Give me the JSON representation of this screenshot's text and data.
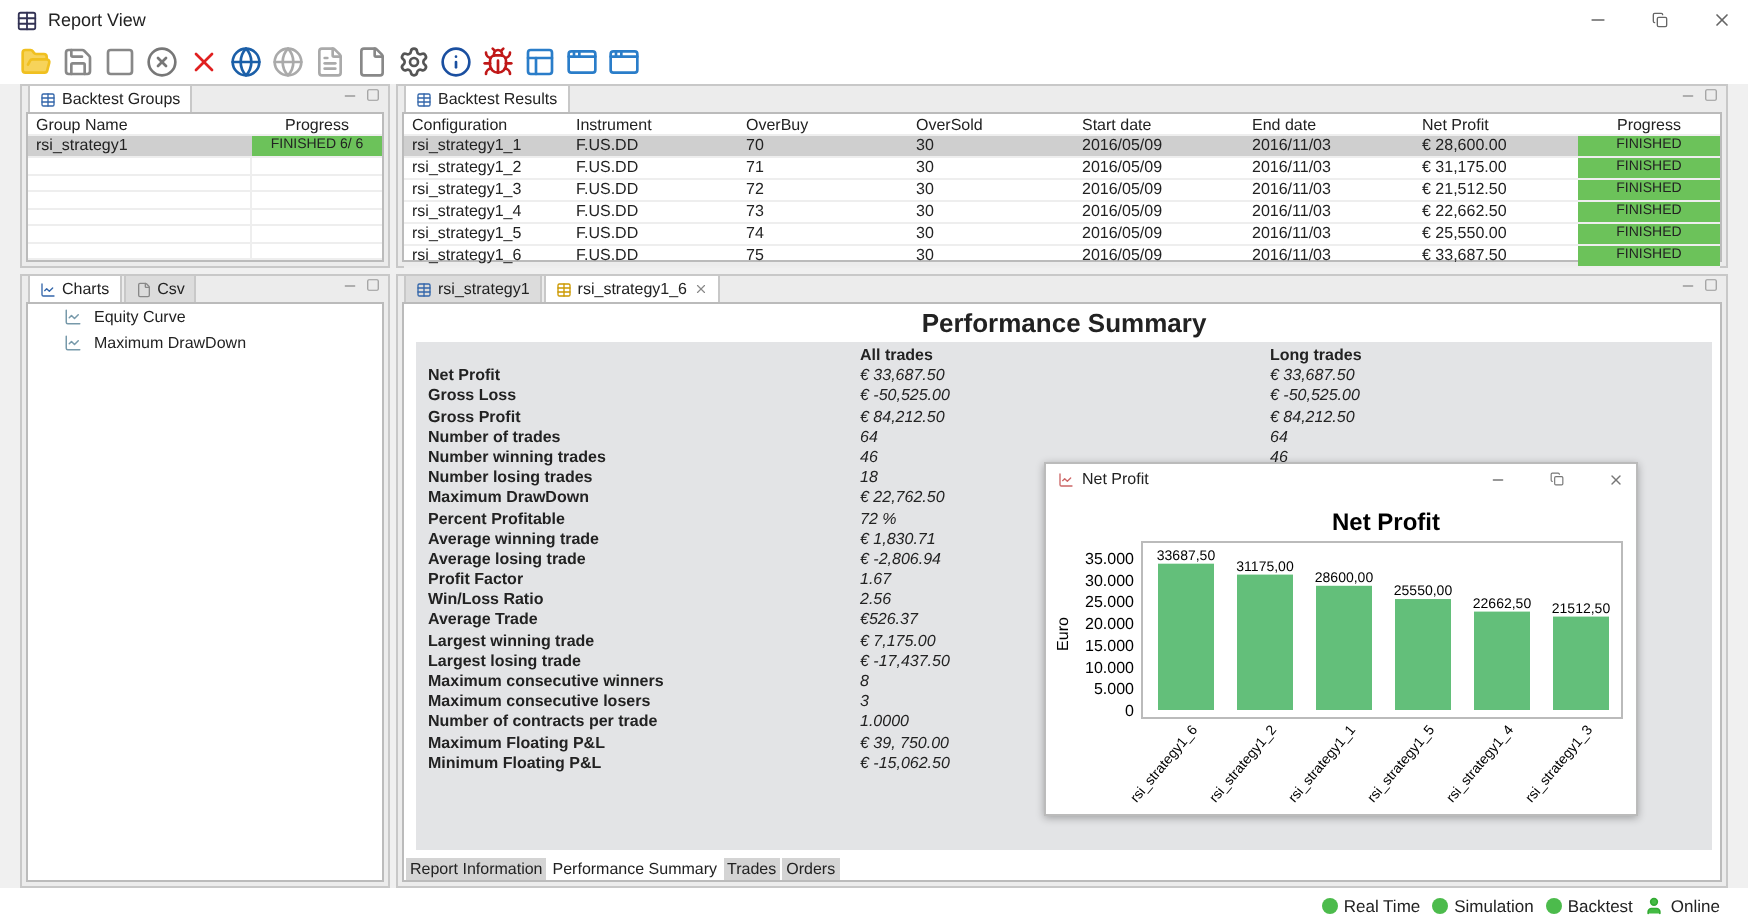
{
  "window": {
    "title": "Report View"
  },
  "groups_panel": {
    "tab": "Backtest Groups",
    "columns": [
      "Group Name",
      "Progress"
    ],
    "rows": [
      {
        "name": "rsi_strategy1",
        "progress": "FINISHED 6/ 6",
        "selected": true
      }
    ]
  },
  "results_panel": {
    "tab": "Backtest Results",
    "columns": [
      "Configuration",
      "Instrument",
      "OverBuy",
      "OverSold",
      "Start date",
      "End date",
      "Net Profit",
      "Progress"
    ],
    "rows": [
      {
        "cells": [
          "rsi_strategy1_1",
          "F.US.DD",
          "70",
          "30",
          "2016/05/09",
          "2016/11/03",
          "€ 28,600.00"
        ],
        "progress": "FINISHED",
        "selected": true
      },
      {
        "cells": [
          "rsi_strategy1_2",
          "F.US.DD",
          "71",
          "30",
          "2016/05/09",
          "2016/11/03",
          "€ 31,175.00"
        ],
        "progress": "FINISHED",
        "selected": false
      },
      {
        "cells": [
          "rsi_strategy1_3",
          "F.US.DD",
          "72",
          "30",
          "2016/05/09",
          "2016/11/03",
          "€ 21,512.50"
        ],
        "progress": "FINISHED",
        "selected": false
      },
      {
        "cells": [
          "rsi_strategy1_4",
          "F.US.DD",
          "73",
          "30",
          "2016/05/09",
          "2016/11/03",
          "€ 22,662.50"
        ],
        "progress": "FINISHED",
        "selected": false
      },
      {
        "cells": [
          "rsi_strategy1_5",
          "F.US.DD",
          "74",
          "30",
          "2016/05/09",
          "2016/11/03",
          "€ 25,550.00"
        ],
        "progress": "FINISHED",
        "selected": false
      },
      {
        "cells": [
          "rsi_strategy1_6",
          "F.US.DD",
          "75",
          "30",
          "2016/05/09",
          "2016/11/03",
          "€ 33,687.50"
        ],
        "progress": "FINISHED",
        "selected": false
      }
    ]
  },
  "charts_panel": {
    "tabs": [
      {
        "label": "Charts",
        "selected": true
      },
      {
        "label": "Csv",
        "selected": false
      }
    ],
    "items": [
      "Equity Curve",
      "Maximum DrawDown"
    ]
  },
  "report_panel": {
    "tabs": [
      {
        "label": "rsi_strategy1",
        "selected": false,
        "closable": false
      },
      {
        "label": "rsi_strategy1_6",
        "selected": true,
        "closable": true
      }
    ],
    "summary": {
      "title": "Performance Summary",
      "headers": [
        "All trades",
        "Long trades"
      ],
      "rows": [
        {
          "label": "Net Profit",
          "all": "€ 33,687.50",
          "long": "€ 33,687.50"
        },
        {
          "label": "Gross Loss",
          "all": "€ -50,525.00",
          "long": "€ -50,525.00"
        },
        {
          "label": "Gross Profit",
          "all": "€ 84,212.50",
          "long": "€ 84,212.50"
        },
        {
          "label": "Number of trades",
          "all": "64",
          "long": "64"
        },
        {
          "label": "Number winning trades",
          "all": "46",
          "long": "46"
        },
        {
          "label": "Number losing trades",
          "all": "18"
        },
        {
          "label": "Maximum DrawDown",
          "all": "€ 22,762.50"
        },
        {
          "label": "Percent Profitable",
          "all": "72 %"
        },
        {
          "label": "Average winning trade",
          "all": "€ 1,830.71"
        },
        {
          "label": "Average losing trade",
          "all": "€ -2,806.94"
        },
        {
          "label": "Profit Factor",
          "all": "1.67"
        },
        {
          "label": "Win/Loss Ratio",
          "all": "2.56"
        },
        {
          "label": "Average Trade",
          "all": "€526.37"
        },
        {
          "label": "Largest winning trade",
          "all": "€ 7,175.00"
        },
        {
          "label": "Largest losing trade",
          "all": "€ -17,437.50"
        },
        {
          "label": "Maximum consecutive winners",
          "all": "8"
        },
        {
          "label": "Maximum consecutive losers",
          "all": "3"
        },
        {
          "label": "Number of contracts per trade",
          "all": "1.0000"
        },
        {
          "label": "Maximum Floating P&L",
          "all": "€ 39, 750.00"
        },
        {
          "label": "Minimum Floating P&L",
          "all": "€ -15,062.50"
        }
      ]
    },
    "popup": {
      "title": "Net Profit",
      "chart_data": {
        "type": "bar",
        "title": "Net Profit",
        "ylabel": "Euro",
        "categories": [
          "rsi_strategy1_6",
          "rsi_strategy1_2",
          "rsi_strategy1_1",
          "rsi_strategy1_5",
          "rsi_strategy1_4",
          "rsi_strategy1_3"
        ],
        "series": [
          {
            "color": "#63bf7a",
            "values": [
              33.69,
              31.18,
              28.6,
              25.55,
              22.66,
              21.51
            ]
          }
        ],
        "value_labels": [
          "33687,50",
          "31175,00",
          "28600,00",
          "25550,00",
          "22662,50",
          "21512,50"
        ],
        "ylim": [
          0,
          35
        ],
        "yticks": [
          {
            "value": 0,
            "label": "0"
          },
          {
            "value": 5,
            "label": "5.000"
          },
          {
            "value": 10,
            "label": "10.000"
          },
          {
            "value": 15,
            "label": "15.000"
          },
          {
            "value": 20,
            "label": "20.000"
          },
          {
            "value": 25,
            "label": "25.000"
          },
          {
            "value": 30,
            "label": "30.000"
          },
          {
            "value": 35,
            "label": "35.000"
          }
        ]
      }
    },
    "bottom_tabs": [
      {
        "label": "Report Information",
        "selected": false
      },
      {
        "label": "Performance Summary",
        "selected": true
      },
      {
        "label": "Trades",
        "selected": false
      },
      {
        "label": "Orders",
        "selected": false
      }
    ]
  },
  "status_bar": [
    {
      "label": "Real Time",
      "kind": "dot"
    },
    {
      "label": "Simulation",
      "kind": "dot"
    },
    {
      "label": "Backtest",
      "kind": "dot"
    },
    {
      "label": "Online",
      "kind": "user"
    }
  ]
}
